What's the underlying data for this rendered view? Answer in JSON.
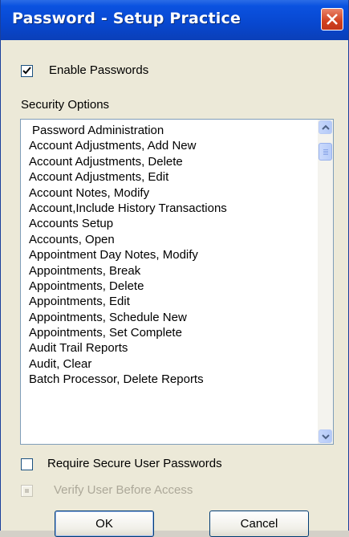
{
  "window": {
    "title": "Password - Setup Practice"
  },
  "enable_passwords": {
    "label": "Enable Passwords",
    "checked": true
  },
  "security_options": {
    "label": "Security Options",
    "items": [
      "Password Administration",
      "Account Adjustments, Add New",
      "Account Adjustments, Delete",
      "Account Adjustments, Edit",
      "Account Notes, Modify",
      "Account,Include History Transactions",
      "Accounts Setup",
      "Accounts, Open",
      "Appointment Day Notes, Modify",
      "Appointments, Break",
      "Appointments, Delete",
      "Appointments, Edit",
      "Appointments, Schedule New",
      "Appointments, Set Complete",
      "Audit Trail Reports",
      "Audit, Clear",
      "Batch Processor, Delete Reports"
    ]
  },
  "require_secure": {
    "label": "Require Secure User Passwords",
    "checked": false
  },
  "verify_user": {
    "label": "Verify User Before Access",
    "checked": true,
    "disabled": true
  },
  "buttons": {
    "ok": "OK",
    "cancel": "Cancel"
  }
}
